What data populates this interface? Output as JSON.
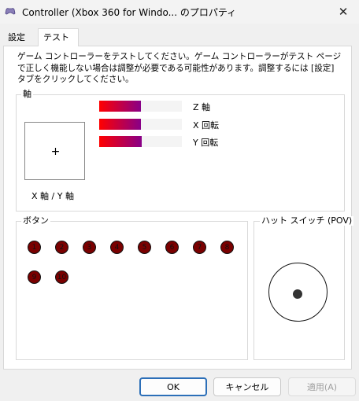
{
  "window": {
    "title": "Controller (Xbox 360 for Windo... のプロパティ",
    "close_glyph": "✕"
  },
  "tabs": [
    {
      "label": "設定"
    },
    {
      "label": "テスト"
    }
  ],
  "description": "ゲーム コントローラーをテストしてください。ゲーム コントローラーがテスト ページで正しく機能しない場合は調整が必要である可能性があります。調整するには [設定] タブをクリックしてください。",
  "axes": {
    "legend": "軸",
    "xy_label": "X 軸 / Y 軸",
    "crosshair": "+",
    "bars": [
      {
        "label": "Z 軸",
        "level": 0.5
      },
      {
        "label": "X 回転",
        "level": 0.5
      },
      {
        "label": "Y 回転",
        "level": 0.51
      }
    ]
  },
  "buttons_group": {
    "legend": "ボタン",
    "buttons": [
      "1",
      "2",
      "3",
      "4",
      "5",
      "6",
      "7",
      "8",
      "9",
      "10"
    ],
    "color": "#7a0000"
  },
  "pov": {
    "legend": "ハット スイッチ (POV)"
  },
  "dialog_buttons": {
    "ok": "OK",
    "cancel": "キャンセル",
    "apply": "適用(A)"
  },
  "colors": {
    "bar_start": "#ff0000",
    "bar_end": "#880088",
    "ok_border": "#2c6fb8"
  }
}
